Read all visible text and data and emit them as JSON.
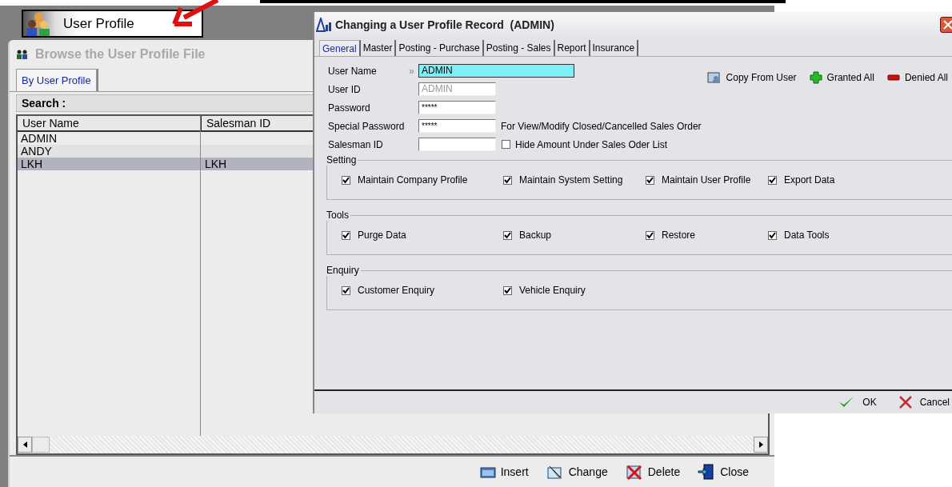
{
  "desktop_label": {
    "text": "User Profile"
  },
  "browse_window": {
    "title": "Browse the User Profile File",
    "tabs": [
      {
        "label": "By User Profile",
        "selected": true
      }
    ],
    "search_label": "Search :",
    "table": {
      "columns": [
        "User Name",
        "Salesman ID"
      ],
      "rows": [
        {
          "user_name": "ADMIN",
          "selected": false
        },
        {
          "user_name": "ANDY",
          "selected": false
        },
        {
          "user_name": "LKH",
          "salesman_id": "LKH",
          "selected": true
        }
      ]
    },
    "buttons": [
      {
        "label": "Insert",
        "kind": "insert"
      },
      {
        "label": "Change",
        "kind": "change"
      },
      {
        "label": "Delete",
        "kind": "delete"
      },
      {
        "label": "Close",
        "kind": "close"
      }
    ]
  },
  "dialog": {
    "title": "Changing a User Profile Record  (ADMIN)",
    "tabs": [
      {
        "label": "General",
        "selected": true
      },
      {
        "label": "Master",
        "selected": false
      },
      {
        "label": "Posting - Purchase",
        "selected": false
      },
      {
        "label": "Posting - Sales",
        "selected": false
      },
      {
        "label": "Report",
        "selected": false
      },
      {
        "label": "Insurance",
        "selected": false
      }
    ],
    "fields": [
      {
        "label": "User Name",
        "marker": "»",
        "value": "ADMIN",
        "kind": "focused"
      },
      {
        "label": "User ID",
        "value": "ADMIN",
        "kind": "disabled"
      },
      {
        "label": "Password",
        "value": "*****",
        "kind": "normal"
      },
      {
        "label": "Special Password",
        "value": "*****",
        "kind": "normal",
        "note": "For View/Modify Closed/Cancelled Sales Order"
      },
      {
        "label": "Salesman ID",
        "kind": "normal",
        "checkbox": {
          "label": "Hide Amount Under Sales Oder List",
          "checked": false
        }
      }
    ],
    "actions": [
      {
        "label": "Copy From User",
        "kind": "copy"
      },
      {
        "label": "Granted All",
        "kind": "grant"
      },
      {
        "label": "Denied All",
        "kind": "deny"
      }
    ],
    "groups": [
      {
        "title": "Setting",
        "items": [
          {
            "label": "Maintain Company Profile",
            "checked": true
          },
          {
            "label": "Maintain System Setting",
            "checked": true
          },
          {
            "label": "Maintain User Profile",
            "checked": true
          },
          {
            "label": "Export Data",
            "checked": true
          }
        ]
      },
      {
        "title": "Tools",
        "items": [
          {
            "label": "Purge Data",
            "checked": true
          },
          {
            "label": "Backup",
            "checked": true
          },
          {
            "label": "Restore",
            "checked": true
          },
          {
            "label": "Data Tools",
            "checked": true
          }
        ]
      },
      {
        "title": "Enquiry",
        "items": [
          {
            "label": "Customer Enquiry",
            "checked": true
          },
          {
            "label": "Vehicle Enquiry",
            "checked": true
          }
        ]
      }
    ],
    "buttons": [
      {
        "label": "OK",
        "kind": "ok"
      },
      {
        "label": "Cancel",
        "kind": "cancel"
      }
    ]
  }
}
